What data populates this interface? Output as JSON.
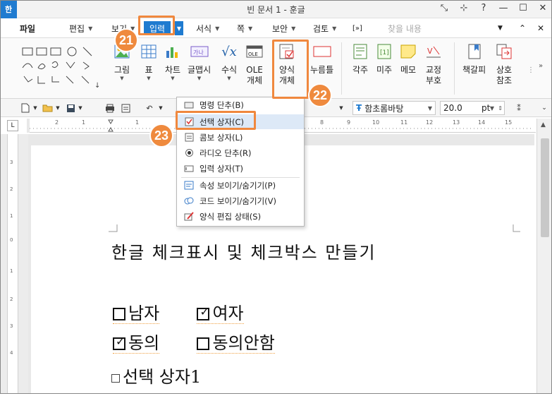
{
  "window": {
    "app_icon": "한",
    "title": "빈 문서 1 - 훈글",
    "controls": [
      "⤡",
      "⊹",
      "?",
      "—",
      "☐",
      "✕"
    ]
  },
  "menubar": {
    "items": [
      {
        "label": "파일"
      },
      {
        "label": "편집"
      },
      {
        "label": "보기"
      },
      {
        "label": "입력",
        "active": true
      },
      {
        "label": "서식"
      },
      {
        "label": "쪽"
      },
      {
        "label": "보안"
      },
      {
        "label": "검토"
      }
    ],
    "search_placeholder": "찾을 내용"
  },
  "ribbon": {
    "buttons": [
      {
        "label": "그림"
      },
      {
        "label": "표"
      },
      {
        "label": "차트"
      },
      {
        "label": "글맵시"
      },
      {
        "label": "수식"
      },
      {
        "label": "OLE\n개체"
      },
      {
        "label": "양식\n개체"
      },
      {
        "label": "누름틀"
      },
      {
        "label": "각주"
      },
      {
        "label": "미주"
      },
      {
        "label": "메모"
      },
      {
        "label": "교정\n부호"
      },
      {
        "label": "책갈피"
      },
      {
        "label": "상호\n참조"
      }
    ]
  },
  "formatbar": {
    "font_name": "함초롬바탕",
    "font_size": "20.0",
    "font_unit": "pt"
  },
  "form_menu": {
    "items": [
      {
        "label": "명령 단추(B)",
        "icon": "command-button-icon"
      },
      {
        "label": "선택 상자(C)",
        "icon": "checkbox-icon",
        "selected": true
      },
      {
        "label": "콤보 상자(L)",
        "icon": "combobox-icon"
      },
      {
        "label": "라디오 단추(R)",
        "icon": "radio-icon"
      },
      {
        "label": "입력 상자(T)",
        "icon": "textbox-icon"
      },
      {
        "label": "속성 보이기/숨기기(P)",
        "icon": "properties-icon"
      },
      {
        "label": "코드 보이기/숨기기(V)",
        "icon": "code-icon"
      },
      {
        "label": "양식 편집 상태(S)",
        "icon": "form-edit-icon"
      }
    ]
  },
  "document": {
    "heading": "한글 체크표시 및 체크박스 만들기",
    "row1": [
      {
        "label": "남자",
        "checked": false
      },
      {
        "label": "여자",
        "checked": true
      }
    ],
    "row2": [
      {
        "label": "동의",
        "checked": true
      },
      {
        "label": "동의안함",
        "checked": false
      }
    ],
    "new_checkbox_label": "선택 상자1"
  },
  "callouts": {
    "step1": "21",
    "step2": "22",
    "step3": "23"
  },
  "colors": {
    "accent": "#1f7bd0",
    "callout": "#ef8a3e"
  }
}
